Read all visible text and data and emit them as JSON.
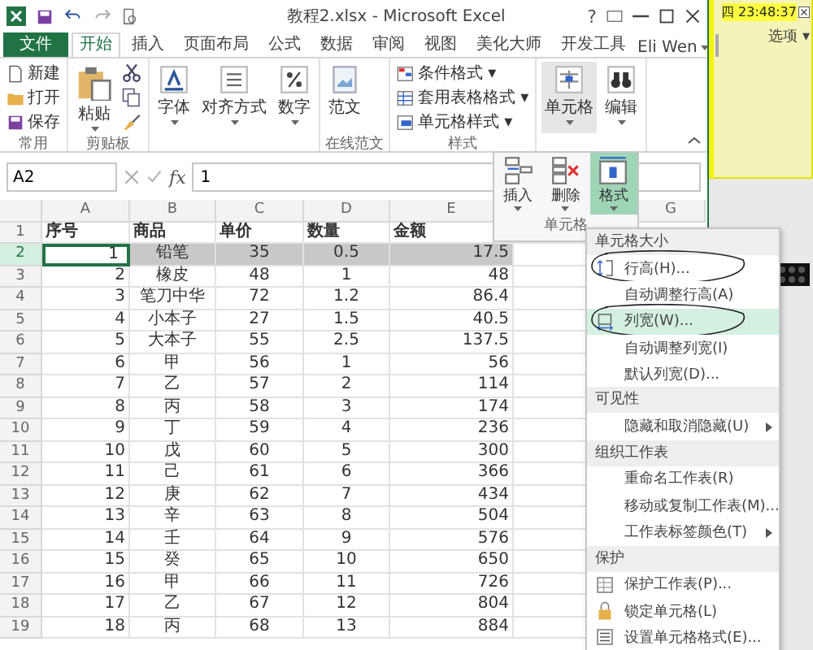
{
  "window": {
    "title": "教程2.xlsx - Microsoft Excel",
    "help": "?"
  },
  "tabs": [
    {
      "label": "文件",
      "kind": "file",
      "selected": false
    },
    {
      "label": "开始",
      "kind": "tab",
      "selected": true
    },
    {
      "label": "插入",
      "kind": "tab",
      "selected": false
    },
    {
      "label": "页面布局",
      "kind": "tab",
      "selected": false
    },
    {
      "label": "公式",
      "kind": "tab",
      "selected": false
    },
    {
      "label": "数据",
      "kind": "tab",
      "selected": false
    },
    {
      "label": "审阅",
      "kind": "tab",
      "selected": false
    },
    {
      "label": "视图",
      "kind": "tab",
      "selected": false
    },
    {
      "label": "美化大师",
      "kind": "tab",
      "selected": false
    },
    {
      "label": "开发工具",
      "kind": "tab",
      "selected": false
    }
  ],
  "account": {
    "name": "Eli Wen"
  },
  "ribbon": {
    "groups": [
      {
        "label": "常用",
        "kind": "stack",
        "items": [
          {
            "label": "新建"
          },
          {
            "label": "打开"
          },
          {
            "label": "保存"
          }
        ]
      },
      {
        "label": "剪贴板",
        "kind": "clipboard",
        "items": [
          {
            "label": "粘贴"
          }
        ]
      },
      {
        "kind": "large",
        "items": [
          {
            "label": "字体",
            "caret": true,
            "selected": false
          },
          {
            "label": "对齐方式",
            "caret": true,
            "selected": false
          },
          {
            "label": "数字",
            "caret": true,
            "selected": false
          }
        ]
      },
      {
        "label": "在线范文",
        "kind": "large",
        "items": [
          {
            "label": "范文",
            "caret": false,
            "selected": false
          }
        ]
      },
      {
        "label": "样式",
        "kind": "stack",
        "items": [
          {
            "label": "条件格式 ▾"
          },
          {
            "label": "套用表格格式 ▾"
          },
          {
            "label": "单元格样式 ▾"
          }
        ]
      },
      {
        "kind": "large",
        "items": [
          {
            "label": "单元格",
            "caret": true,
            "selected": true
          },
          {
            "label": "编辑",
            "caret": true,
            "selected": false
          }
        ]
      }
    ]
  },
  "formula_bar": {
    "name_box": "A2",
    "fx": "fx",
    "value": "1"
  },
  "sheet": {
    "columns": [
      "A",
      "B",
      "C",
      "D",
      "E",
      "G"
    ],
    "rows": [
      {
        "number": "1",
        "kind": "header",
        "selected": false,
        "cells": [
          "序号",
          "商品",
          "单价",
          "数量",
          "金额"
        ]
      },
      {
        "number": "2",
        "kind": "data",
        "selected": true,
        "cells": [
          "1",
          "铅笔",
          "35",
          "0.5",
          "17.5"
        ]
      },
      {
        "number": "3",
        "kind": "data",
        "selected": false,
        "cells": [
          "2",
          "橡皮",
          "48",
          "1",
          "48"
        ]
      },
      {
        "number": "4",
        "kind": "data",
        "selected": false,
        "cells": [
          "3",
          "笔刀中华",
          "72",
          "1.2",
          "86.4"
        ]
      },
      {
        "number": "5",
        "kind": "data",
        "selected": false,
        "cells": [
          "4",
          "小本子",
          "27",
          "1.5",
          "40.5"
        ]
      },
      {
        "number": "6",
        "kind": "data",
        "selected": false,
        "cells": [
          "5",
          "大本子",
          "55",
          "2.5",
          "137.5"
        ]
      },
      {
        "number": "7",
        "kind": "data",
        "selected": false,
        "cells": [
          "6",
          "甲",
          "56",
          "1",
          "56"
        ]
      },
      {
        "number": "8",
        "kind": "data",
        "selected": false,
        "cells": [
          "7",
          "乙",
          "57",
          "2",
          "114"
        ]
      },
      {
        "number": "9",
        "kind": "data",
        "selected": false,
        "cells": [
          "8",
          "丙",
          "58",
          "3",
          "174"
        ]
      },
      {
        "number": "10",
        "kind": "data",
        "selected": false,
        "cells": [
          "9",
          "丁",
          "59",
          "4",
          "236"
        ]
      },
      {
        "number": "11",
        "kind": "data",
        "selected": false,
        "cells": [
          "10",
          "戊",
          "60",
          "5",
          "300"
        ]
      },
      {
        "number": "12",
        "kind": "data",
        "selected": false,
        "cells": [
          "11",
          "己",
          "61",
          "6",
          "366"
        ]
      },
      {
        "number": "13",
        "kind": "data",
        "selected": false,
        "cells": [
          "12",
          "庚",
          "62",
          "7",
          "434"
        ]
      },
      {
        "number": "14",
        "kind": "data",
        "selected": false,
        "cells": [
          "13",
          "辛",
          "63",
          "8",
          "504"
        ]
      },
      {
        "number": "15",
        "kind": "data",
        "selected": false,
        "cells": [
          "14",
          "壬",
          "64",
          "9",
          "576"
        ]
      },
      {
        "number": "16",
        "kind": "data",
        "selected": false,
        "cells": [
          "15",
          "癸",
          "65",
          "10",
          "650"
        ]
      },
      {
        "number": "17",
        "kind": "data",
        "selected": false,
        "cells": [
          "16",
          "甲",
          "66",
          "11",
          "726"
        ]
      },
      {
        "number": "18",
        "kind": "data",
        "selected": false,
        "cells": [
          "17",
          "乙",
          "67",
          "12",
          "804"
        ]
      },
      {
        "number": "19",
        "kind": "data",
        "selected": false,
        "cells": [
          "18",
          "丙",
          "68",
          "13",
          "884"
        ]
      }
    ]
  },
  "cell_popup": {
    "label": "单元格",
    "buttons": [
      {
        "label": "插入",
        "selected": false
      },
      {
        "label": "删除",
        "selected": false
      },
      {
        "label": "格式",
        "selected": true
      }
    ]
  },
  "format_menu": {
    "sections": [
      {
        "title": "单元格大小",
        "items": [
          {
            "label": "行高(H)...",
            "highlighted": false,
            "submenu": false,
            "circled": true
          },
          {
            "label": "自动调整行高(A)",
            "highlighted": false,
            "submenu": false,
            "circled": false
          },
          {
            "label": "列宽(W)...",
            "highlighted": true,
            "submenu": false,
            "circled": true
          },
          {
            "label": "自动调整列宽(I)",
            "highlighted": false,
            "submenu": false,
            "circled": false
          },
          {
            "label": "默认列宽(D)...",
            "highlighted": false,
            "submenu": false,
            "circled": false
          }
        ]
      },
      {
        "title": "可见性",
        "items": [
          {
            "label": "隐藏和取消隐藏(U)",
            "highlighted": false,
            "submenu": true,
            "circled": false
          }
        ]
      },
      {
        "title": "组织工作表",
        "items": [
          {
            "label": "重命名工作表(R)",
            "highlighted": false,
            "submenu": false,
            "circled": false
          },
          {
            "label": "移动或复制工作表(M)...",
            "highlighted": false,
            "submenu": false,
            "circled": false
          },
          {
            "label": "工作表标签颜色(T)",
            "highlighted": false,
            "submenu": true,
            "circled": false
          }
        ]
      },
      {
        "title": "保护",
        "items": [
          {
            "label": "保护工作表(P)...",
            "highlighted": false,
            "submenu": false,
            "circled": false
          },
          {
            "label": "锁定单元格(L)",
            "highlighted": false,
            "submenu": false,
            "circled": false
          },
          {
            "label": "设置单元格格式(E)...",
            "highlighted": false,
            "submenu": false,
            "circled": false
          }
        ]
      }
    ]
  },
  "clock": {
    "time": "四 23:48:37",
    "options": "选项 ▾"
  }
}
